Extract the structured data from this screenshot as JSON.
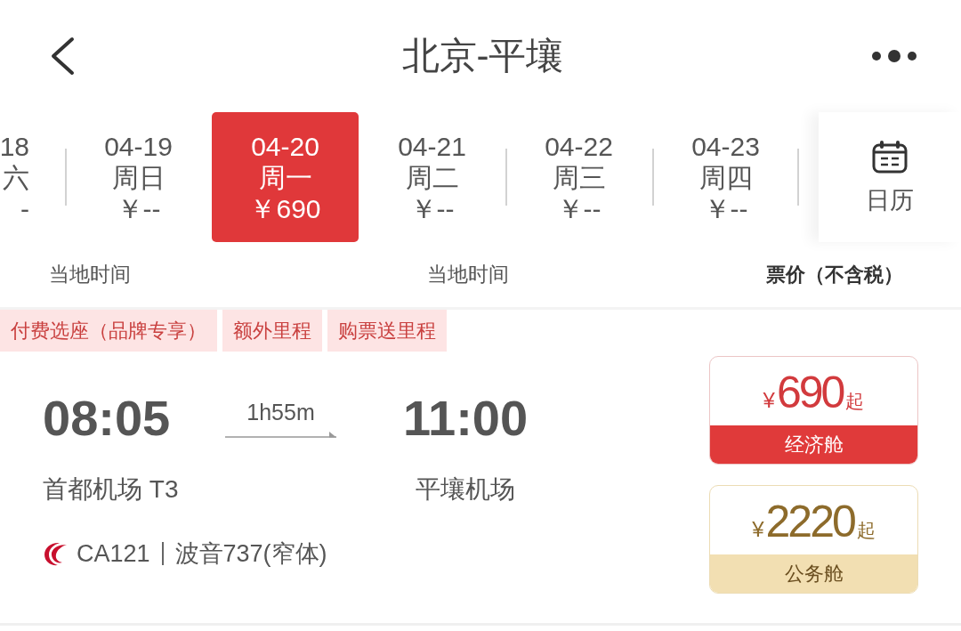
{
  "header": {
    "title": "北京-平壤"
  },
  "dates": [
    {
      "date": "18",
      "weekday": "六",
      "price": "-",
      "selected": false
    },
    {
      "date": "04-19",
      "weekday": "周日",
      "price": "￥--",
      "selected": false
    },
    {
      "date": "04-20",
      "weekday": "周一",
      "price": "￥690",
      "selected": true
    },
    {
      "date": "04-21",
      "weekday": "周二",
      "price": "￥--",
      "selected": false
    },
    {
      "date": "04-22",
      "weekday": "周三",
      "price": "￥--",
      "selected": false
    },
    {
      "date": "04-23",
      "weekday": "周四",
      "price": "￥--",
      "selected": false
    }
  ],
  "calendar_button": {
    "label": "日历"
  },
  "columns": [
    {
      "label": "当地时间",
      "kind": "time"
    },
    {
      "label": "当地时间",
      "kind": "time"
    },
    {
      "label": "票价（不含税）",
      "kind": "price"
    }
  ],
  "tags": [
    "付费选座（品牌专享）",
    "额外里程",
    "购票送里程"
  ],
  "flight": {
    "departure": {
      "time": "08:05",
      "airport": "首都机场 T3"
    },
    "duration": "1h55m",
    "arrival": {
      "time": "11:00",
      "airport": "平壤机场"
    },
    "flight_number": "CA121",
    "aircraft": "波音737(窄体)",
    "fares": [
      {
        "kind": "economy",
        "currency": "¥",
        "amount": "690",
        "suffix": "起",
        "cabin": "经济舱"
      },
      {
        "kind": "business",
        "currency": "¥",
        "amount": "2220",
        "suffix": "起",
        "cabin": "公务舱"
      }
    ]
  }
}
